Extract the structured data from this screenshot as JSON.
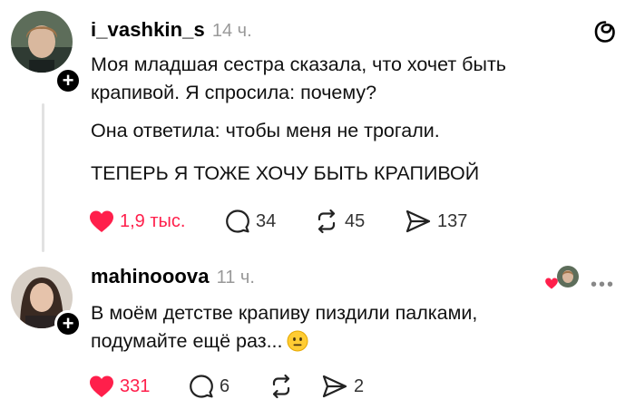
{
  "posts": [
    {
      "username": "i_vashkin_s",
      "time": "14 ч.",
      "text_lines": [
        "Моя младшая сестра сказала, что хочет быть",
        "крапивой. Я спросила: почему?"
      ],
      "text_line2": "Она ответила: чтобы меня не трогали.",
      "text_line3": "ТЕПЕРЬ Я ТОЖЕ ХОЧУ БЫТЬ КРАПИВОЙ",
      "likes": "1,9 тыс.",
      "comments": "34",
      "reposts": "45",
      "shares": "137"
    },
    {
      "username": "mahinooova",
      "time": "11 ч.",
      "text_lines": [
        "В моём детстве крапиву пиздили палками,",
        "подумайте ещё раз..."
      ],
      "likes": "331",
      "comments": "6",
      "reposts": "",
      "shares": "2"
    }
  ],
  "colors": {
    "like": "#ff1f4b",
    "muted": "#999999"
  },
  "icons": [
    "plus-icon",
    "threads-logo-icon",
    "heart-icon",
    "comment-icon",
    "repost-icon",
    "share-icon",
    "more-icon",
    "neutral-face-emoji-icon"
  ]
}
